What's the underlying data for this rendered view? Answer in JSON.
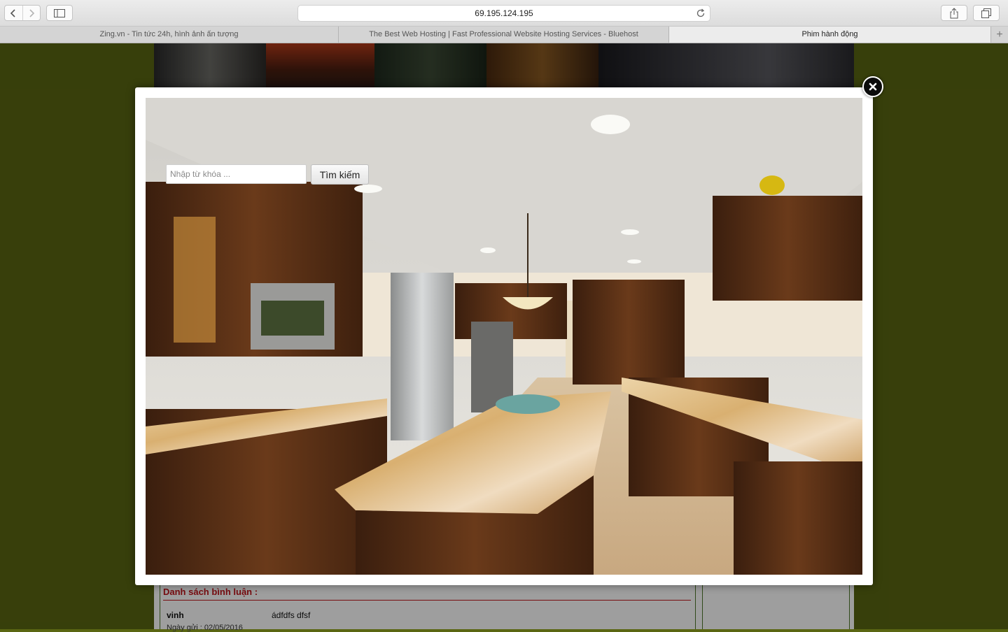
{
  "browser": {
    "url": "69.195.124.195",
    "tabs": [
      {
        "label": "Zing.vn - Tin tức 24h, hình ảnh ấn tượng",
        "active": false
      },
      {
        "label": "The Best Web Hosting | Fast Professional Website Hosting Services - Bluehost",
        "active": false
      },
      {
        "label": "Phim hành động",
        "active": true
      }
    ],
    "new_tab_label": "+"
  },
  "search": {
    "placeholder": "Nhập từ khóa ...",
    "value": "",
    "button_label": "Tìm kiếm"
  },
  "comments": {
    "heading": "Danh sách bình luận :",
    "items": [
      {
        "author": "vinh",
        "text": "ádfdfs dfsf",
        "date": "Ngày gửi : 02/05/2016"
      }
    ]
  },
  "colors": {
    "page_background": "#5a6612",
    "heading_red": "#c0141b",
    "border_green": "#4f7a2a"
  }
}
